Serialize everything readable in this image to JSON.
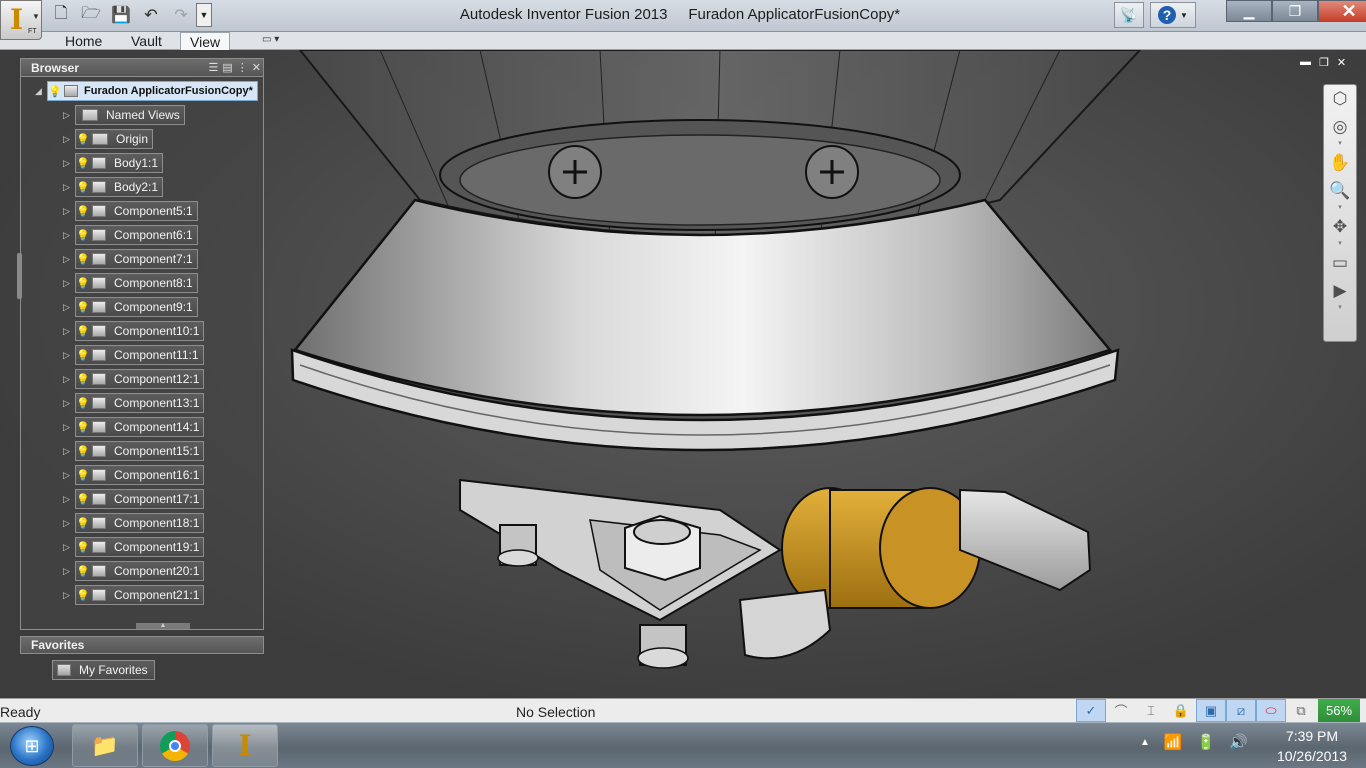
{
  "titlebar": {
    "title": "Autodesk Inventor Fusion 2013     Furadon ApplicatorFusionCopy*",
    "logo_letter": "I",
    "logo_badge": "FT",
    "window_controls": [
      "minimize",
      "restore",
      "close"
    ]
  },
  "quick_access": [
    "new-icon",
    "open-icon",
    "save-icon",
    "undo-icon",
    "redo-icon"
  ],
  "ribbon": {
    "tabs": [
      {
        "label": "Home",
        "active": false
      },
      {
        "label": "Vault",
        "active": false
      },
      {
        "label": "View",
        "active": true
      }
    ]
  },
  "browser": {
    "title": "Browser",
    "root": "Furadon ApplicatorFusionCopy*",
    "items": [
      {
        "label": "Named Views",
        "type": "folder",
        "visible": false
      },
      {
        "label": "Origin",
        "type": "folder",
        "visible": false
      },
      {
        "label": "Body1:1",
        "type": "body",
        "visible": true
      },
      {
        "label": "Body2:1",
        "type": "body",
        "visible": true
      },
      {
        "label": "Component5:1",
        "type": "component",
        "visible": true
      },
      {
        "label": "Component6:1",
        "type": "component",
        "visible": true
      },
      {
        "label": "Component7:1",
        "type": "component",
        "visible": true
      },
      {
        "label": "Component8:1",
        "type": "component",
        "visible": true
      },
      {
        "label": "Component9:1",
        "type": "component",
        "visible": true
      },
      {
        "label": "Component10:1",
        "type": "component",
        "visible": true
      },
      {
        "label": "Component11:1",
        "type": "component",
        "visible": true
      },
      {
        "label": "Component12:1",
        "type": "component",
        "visible": true
      },
      {
        "label": "Component13:1",
        "type": "component",
        "visible": true
      },
      {
        "label": "Component14:1",
        "type": "component",
        "visible": true
      },
      {
        "label": "Component15:1",
        "type": "component",
        "visible": true
      },
      {
        "label": "Component16:1",
        "type": "component",
        "visible": true
      },
      {
        "label": "Component17:1",
        "type": "component",
        "visible": true
      },
      {
        "label": "Component18:1",
        "type": "component",
        "visible": true
      },
      {
        "label": "Component19:1",
        "type": "component",
        "visible": true
      },
      {
        "label": "Component20:1",
        "type": "component",
        "visible": true
      },
      {
        "label": "Component21:1",
        "type": "component",
        "visible": true
      }
    ]
  },
  "favorites": {
    "title": "Favorites",
    "items": [
      "My Favorites"
    ]
  },
  "navbar": [
    "view-cube-icon",
    "steering-wheel-icon",
    "pan-icon",
    "zoom-icon",
    "orbit-icon",
    "look-at-icon",
    "record-icon"
  ],
  "status": {
    "left": "Ready",
    "center": "No Selection",
    "percent": "56%"
  },
  "taskbar": {
    "apps": [
      "file-explorer-icon",
      "chrome-icon",
      "inventor-fusion-icon"
    ],
    "time": "7:39 PM",
    "date": "10/26/2013"
  },
  "colors": {
    "accent": "#7ba7d5",
    "brass": "#c8961d",
    "status_green": "#3fae4a"
  }
}
